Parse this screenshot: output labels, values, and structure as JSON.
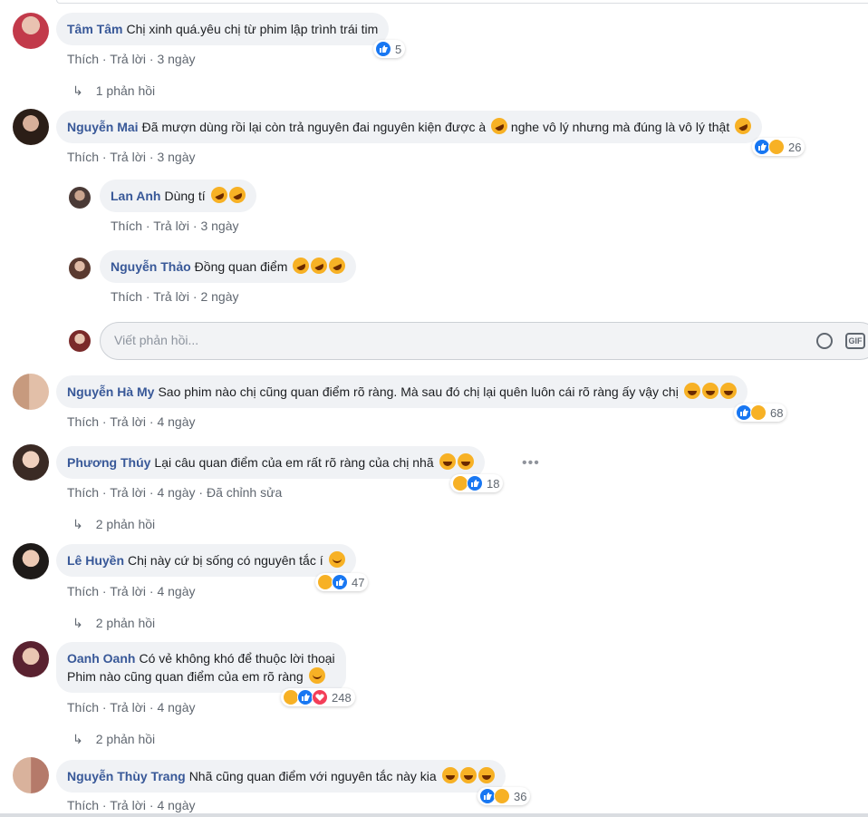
{
  "placeholder": "Viết phản hồi...",
  "gif_label": "GIF",
  "actions": {
    "like": "Thích",
    "reply": "Trả lời",
    "sep": " · "
  },
  "comments": [
    {
      "name": "Tâm Tâm",
      "text": "Chị xinh quá.yêu chị từ phim lập trình trái tim",
      "time": "3 ngày",
      "reactions": [
        "like"
      ],
      "count": "5",
      "replies": "1 phản hồi"
    },
    {
      "name": "Nguyễn Mai",
      "text": "Đã mượn dùng rồi lại còn trả nguyên đai nguyên kiện được à",
      "text2": "nghe vô lý nhưng mà đúng là vô lý thật",
      "time": "3 ngày",
      "reactions": [
        "like",
        "haha"
      ],
      "count": "26"
    },
    {
      "name": "Lan Anh",
      "text": "Dùng tí",
      "time": "3 ngày"
    },
    {
      "name": "Nguyễn Thảo",
      "text": "Đồng quan điểm",
      "time": "2 ngày"
    },
    {
      "name": "Nguyễn Hà My",
      "text": "Sao phim nào chị cũng quan điểm rõ ràng. Mà sau đó chị lại quên luôn cái rõ ràng ấy vậy chị",
      "time": "4 ngày",
      "reactions": [
        "like",
        "haha"
      ],
      "count": "68"
    },
    {
      "name": "Phương Thúy",
      "text": "Lại câu quan điểm của em rất rõ ràng của chị nhã",
      "time": "4 ngày",
      "edited": "Đã chỉnh sửa",
      "reactions": [
        "haha",
        "like"
      ],
      "count": "18",
      "replies": "2 phản hồi"
    },
    {
      "name": "Lê Huyền",
      "text": "Chị này cứ bị sống có nguyên tắc í",
      "time": "4 ngày",
      "reactions": [
        "haha",
        "like"
      ],
      "count": "47",
      "replies": "2 phản hồi"
    },
    {
      "name": "Oanh Oanh",
      "text": "Có vẻ không khó để thuộc lời thoại",
      "text2": "Phim nào cũng quan điểm của em rõ ràng",
      "time": "4 ngày",
      "reactions": [
        "haha",
        "like",
        "love"
      ],
      "count": "248",
      "replies": "2 phản hồi"
    },
    {
      "name": "Nguyễn Thùy Trang",
      "text": "Nhã cũng quan điểm với nguyên tắc này kia",
      "time": "4 ngày",
      "reactions": [
        "like",
        "haha"
      ],
      "count": "36"
    }
  ],
  "colors": {
    "name": "#385898",
    "bubble": "#f0f2f5",
    "like": "#1877f2",
    "haha": "#f7b125",
    "love": "#f33e58"
  }
}
